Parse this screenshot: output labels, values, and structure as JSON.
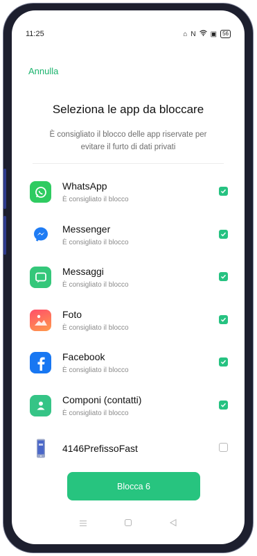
{
  "status": {
    "time": "11:25",
    "battery": "56"
  },
  "header": {
    "cancel_label": "Annulla",
    "title": "Seleziona le app da bloccare",
    "subtitle": "È consigliato il blocco delle app riservate per evitare il furto di dati privati"
  },
  "apps": [
    {
      "name": "WhatsApp",
      "sub": "È consigliato il blocco",
      "checked": true,
      "icon": "whatsapp-icon",
      "color": "#2fcb61"
    },
    {
      "name": "Messenger",
      "sub": "È consigliato il blocco",
      "checked": true,
      "icon": "messenger-icon",
      "color": "#1f7cf4"
    },
    {
      "name": "Messaggi",
      "sub": "È consigliato il blocco",
      "checked": true,
      "icon": "messages-icon",
      "color": "#34c77a"
    },
    {
      "name": "Foto",
      "sub": "È consigliato il blocco",
      "checked": true,
      "icon": "photos-icon",
      "color": "#ff6f5b"
    },
    {
      "name": "Facebook",
      "sub": "È consigliato il blocco",
      "checked": true,
      "icon": "facebook-icon",
      "color": "#1877f2"
    },
    {
      "name": "Componi (contatti)",
      "sub": "È consigliato il blocco",
      "checked": true,
      "icon": "contacts-icon",
      "color": "#35c486"
    },
    {
      "name": "4146PrefissoFast",
      "sub": "",
      "checked": false,
      "icon": "phone-app-icon",
      "color": "#5d7bd6"
    }
  ],
  "action": {
    "lock_label": "Blocca 6"
  },
  "colors": {
    "accent": "#27c47f",
    "link": "#1bb36d"
  }
}
